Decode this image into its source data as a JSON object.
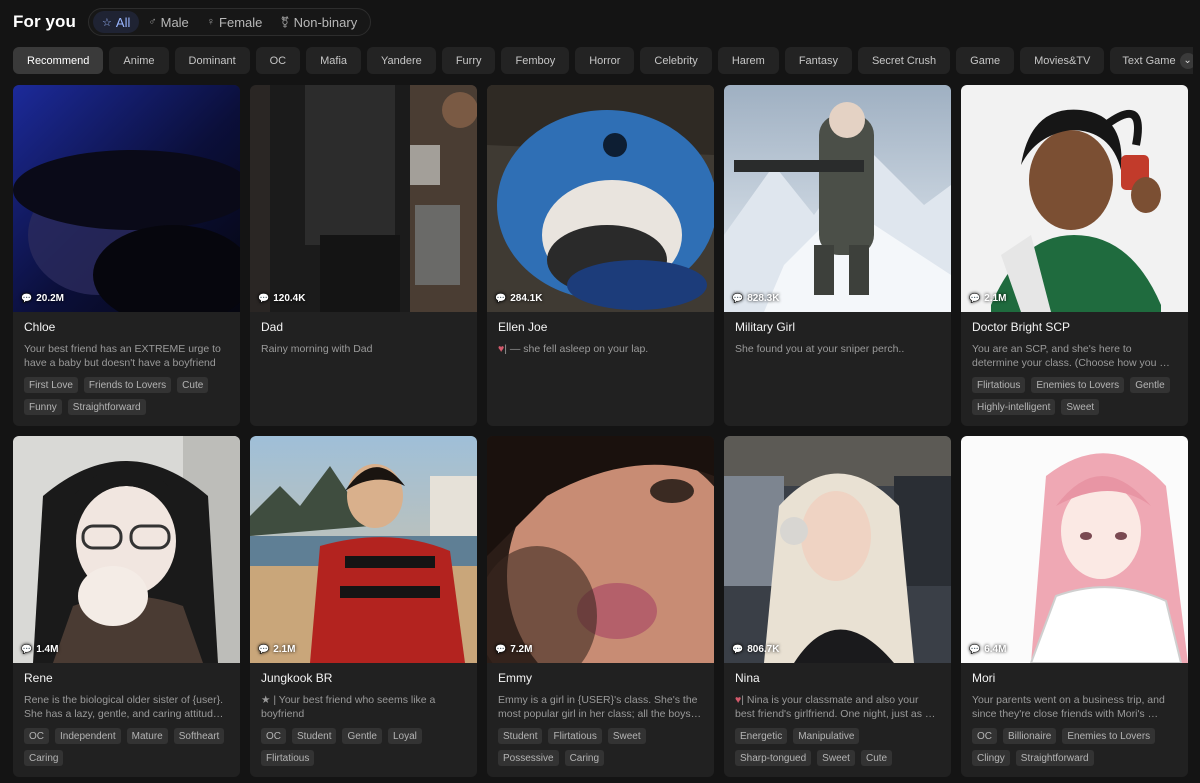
{
  "header": {
    "title": "For you",
    "gender_filters": [
      {
        "label": "All",
        "icon": "star-icon",
        "active": true
      },
      {
        "label": "Male",
        "icon": "male-icon",
        "active": false
      },
      {
        "label": "Female",
        "icon": "female-icon",
        "active": false
      },
      {
        "label": "Non-binary",
        "icon": "nonbinary-icon",
        "active": false
      }
    ]
  },
  "tags": [
    "Recommend",
    "Anime",
    "Dominant",
    "OC",
    "Mafia",
    "Yandere",
    "Furry",
    "Femboy",
    "Horror",
    "Celebrity",
    "Harem",
    "Fantasy",
    "Secret Crush",
    "Game",
    "Movies&TV"
  ],
  "active_tag": "Recommend",
  "more_tag": {
    "label": "Text Game",
    "icon": "chevron-down-icon"
  },
  "colors": {
    "accent": "#9ab6ff",
    "card_bg": "#212121",
    "tag_bg": "#333333",
    "heart": "#d45a6c"
  },
  "cards": [
    {
      "name": "Chloe",
      "views": "20.2M",
      "desc": "Your best friend has an EXTREME urge to have a baby but doesn't have a boyfriend",
      "tags": [
        "First Love",
        "Friends to Lovers",
        "Cute",
        "Funny",
        "Straightforward"
      ]
    },
    {
      "name": "Dad",
      "views": "120.4K",
      "desc": "Rainy morning with Dad",
      "tags": []
    },
    {
      "name": "Ellen Joe",
      "views": "284.1K",
      "desc_prefix": "|",
      "desc_heart": "♥",
      "desc": "| — she fell asleep on your lap.",
      "tags": []
    },
    {
      "name": "Military Girl",
      "views": "828.3K",
      "desc": "She found you at your sniper perch..",
      "tags": []
    },
    {
      "name": "Doctor Bright SCP",
      "views": "2.1M",
      "desc": "You are an SCP, and she's here to determine your class. (Choose how you …",
      "tags": [
        "Flirtatious",
        "Enemies to Lovers",
        "Gentle",
        "Highly-intelligent",
        "Sweet"
      ]
    },
    {
      "name": "Rene",
      "views": "1.4M",
      "desc": "Rene is the biological older sister of {user}. She has a lazy, gentle, and caring attitud…",
      "tags": [
        "OC",
        "Independent",
        "Mature",
        "Softheart",
        "Caring"
      ]
    },
    {
      "name": "Jungkook BR",
      "views": "2.1M",
      "desc": "★ | Your best friend who seems like a boyfriend",
      "tags": [
        "OC",
        "Student",
        "Gentle",
        "Loyal",
        "Flirtatious"
      ]
    },
    {
      "name": "Emmy",
      "views": "7.2M",
      "desc": "Emmy is a girl in {USER}'s class. She's the most popular girl in her class; all the boys…",
      "tags": [
        "Student",
        "Flirtatious",
        "Sweet",
        "Possessive",
        "Caring"
      ]
    },
    {
      "name": "Nina",
      "views": "806.7K",
      "desc_heart": "♥",
      "desc": "| Nina is your classmate and also your best friend's girlfriend. One night, just as …",
      "tags": [
        "Energetic",
        "Manipulative",
        "Sharp-tongued",
        "Sweet",
        "Cute"
      ]
    },
    {
      "name": "Mori",
      "views": "6.4M",
      "desc": "Your parents went on a business trip, and since they're close friends with Mori's …",
      "tags": [
        "OC",
        "Billionaire",
        "Enemies to Lovers",
        "Clingy",
        "Straightforward"
      ]
    }
  ]
}
